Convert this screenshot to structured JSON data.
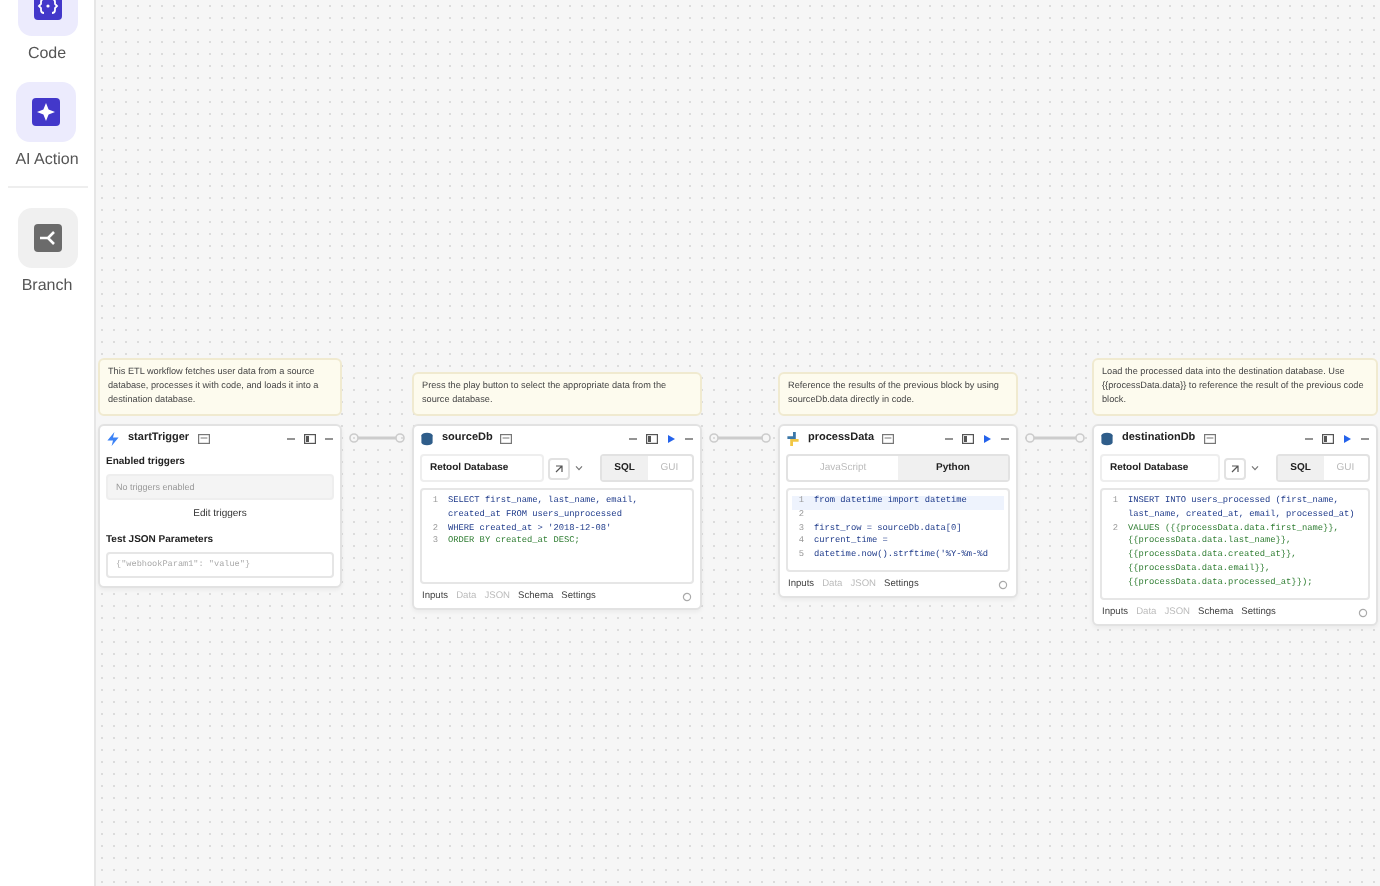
{
  "sidebar": {
    "items": [
      {
        "label": "Code",
        "kind": "code"
      },
      {
        "label": "AI Action",
        "kind": "ai"
      },
      {
        "label": "Branch",
        "kind": "branch"
      }
    ]
  },
  "blocks": [
    {
      "kind": "trigger",
      "name": "startTrigger",
      "note": "This ETL workflow fetches user data from a source database, processes it with code, and loads it into a destination database.",
      "runnable": false,
      "triggers_label": "Enabled triggers",
      "triggers_placeholder": "No triggers enabled",
      "edit_button": "Edit triggers",
      "params_label": "Test JSON Parameters",
      "params_placeholder": "{\"webhookParam1\": \"value\"}"
    },
    {
      "kind": "sql",
      "name": "sourceDb",
      "note": "Press the play button to select the appropriate data from the source database.",
      "runnable": true,
      "resource": "Retool Database",
      "modes": [
        {
          "label": "SQL",
          "selected": true
        },
        {
          "label": "GUI",
          "selected": false
        }
      ],
      "code": [
        {
          "number": "1",
          "text": "SELECT first_name, last_name, email, created_at FROM users_unprocessed"
        },
        {
          "number": "2",
          "text": "WHERE created_at > '2018-12-08'"
        },
        {
          "number": "3",
          "text": "ORDER BY created_at DESC;"
        }
      ],
      "tabs": [
        {
          "label": "Inputs",
          "disabled": false
        },
        {
          "label": "Data",
          "disabled": true
        },
        {
          "label": "JSON",
          "disabled": true
        },
        {
          "label": "Schema",
          "disabled": false
        },
        {
          "label": "Settings",
          "disabled": false
        }
      ]
    },
    {
      "kind": "code",
      "name": "processData",
      "note": "Reference the results of the previous block by using sourceDb.data directly in code.",
      "runnable": true,
      "modes": [
        {
          "label": "JavaScript",
          "selected": false
        },
        {
          "label": "Python",
          "selected": true
        }
      ],
      "code": [
        {
          "number": "1",
          "text": "from datetime import datetime"
        },
        {
          "number": "2"
        },
        {
          "number": "3",
          "text": "first_row = sourceDb.data[0]"
        },
        {
          "number": "4",
          "text": "current_time ="
        },
        {
          "number": "5",
          "text": "datetime.now().strftime('%Y-%m-%d"
        }
      ],
      "tabs": [
        {
          "label": "Inputs",
          "disabled": false
        },
        {
          "label": "Data",
          "disabled": true
        },
        {
          "label": "JSON",
          "disabled": true
        },
        {
          "label": "Settings",
          "disabled": false
        }
      ]
    },
    {
      "kind": "sql",
      "name": "destinationDb",
      "note": "Load the processed data into the destination database. Use {{processData.data}} to reference the result of the previous code block.",
      "runnable": true,
      "resource": "Retool Database",
      "modes": [
        {
          "label": "SQL",
          "selected": true
        },
        {
          "label": "GUI",
          "selected": false
        }
      ],
      "code": [
        {
          "number": "1",
          "text": "INSERT INTO users_processed (first_name, last_name, created_at, email, processed_at)"
        },
        {
          "number": "2",
          "text": "VALUES ({{processData.data.first_name}}, {{processData.data.last_name}}, {{processData.data.created_at}}, {{processData.data.email}}, {{processData.data.processed_at}});"
        }
      ],
      "tabs": [
        {
          "label": "Inputs",
          "disabled": false
        },
        {
          "label": "Data",
          "disabled": true
        },
        {
          "label": "JSON",
          "disabled": true
        },
        {
          "label": "Schema",
          "disabled": false
        },
        {
          "label": "Settings",
          "disabled": false
        }
      ]
    }
  ]
}
